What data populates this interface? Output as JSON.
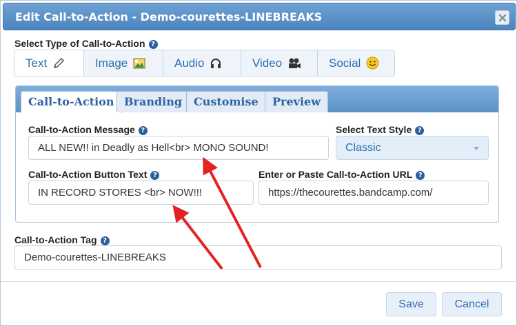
{
  "window": {
    "title": "Edit Call-to-Action - Demo-courettes-LINEBREAKS",
    "close_icon": "close-icon"
  },
  "type_section": {
    "label": "Select Type of Call-to-Action",
    "types": [
      {
        "label": "Text",
        "icon": "pencil-icon",
        "selected": true
      },
      {
        "label": "Image",
        "icon": "picture-icon",
        "selected": false
      },
      {
        "label": "Audio",
        "icon": "headphones-icon",
        "selected": false
      },
      {
        "label": "Video",
        "icon": "film-camera-icon",
        "selected": false
      },
      {
        "label": "Social",
        "icon": "smiley-icon",
        "selected": false
      }
    ]
  },
  "tabs": [
    {
      "label": "Call-to-Action",
      "active": true
    },
    {
      "label": "Branding",
      "active": false
    },
    {
      "label": "Customise",
      "active": false
    },
    {
      "label": "Preview",
      "active": false
    }
  ],
  "form": {
    "message": {
      "label": "Call-to-Action Message",
      "value": "ALL NEW!! in Deadly as Hell<br> MONO SOUND!"
    },
    "text_style": {
      "label": "Select Text Style",
      "value": "Classic"
    },
    "button_text": {
      "label": "Call-to-Action Button Text",
      "value": "IN RECORD STORES <br> NOW!!!"
    },
    "url": {
      "label": "Enter or Paste Call-to-Action URL",
      "value": "https://thecourettes.bandcamp.com/"
    },
    "tag": {
      "label": "Call-to-Action Tag",
      "value": "Demo-courettes-LINEBREAKS"
    }
  },
  "footer": {
    "save_label": "Save",
    "cancel_label": "Cancel"
  },
  "help_glyph": "?",
  "colors": {
    "titlebar": "#4b84bf",
    "accent": "#2f6db0",
    "annotation_arrow": "#e32222"
  }
}
